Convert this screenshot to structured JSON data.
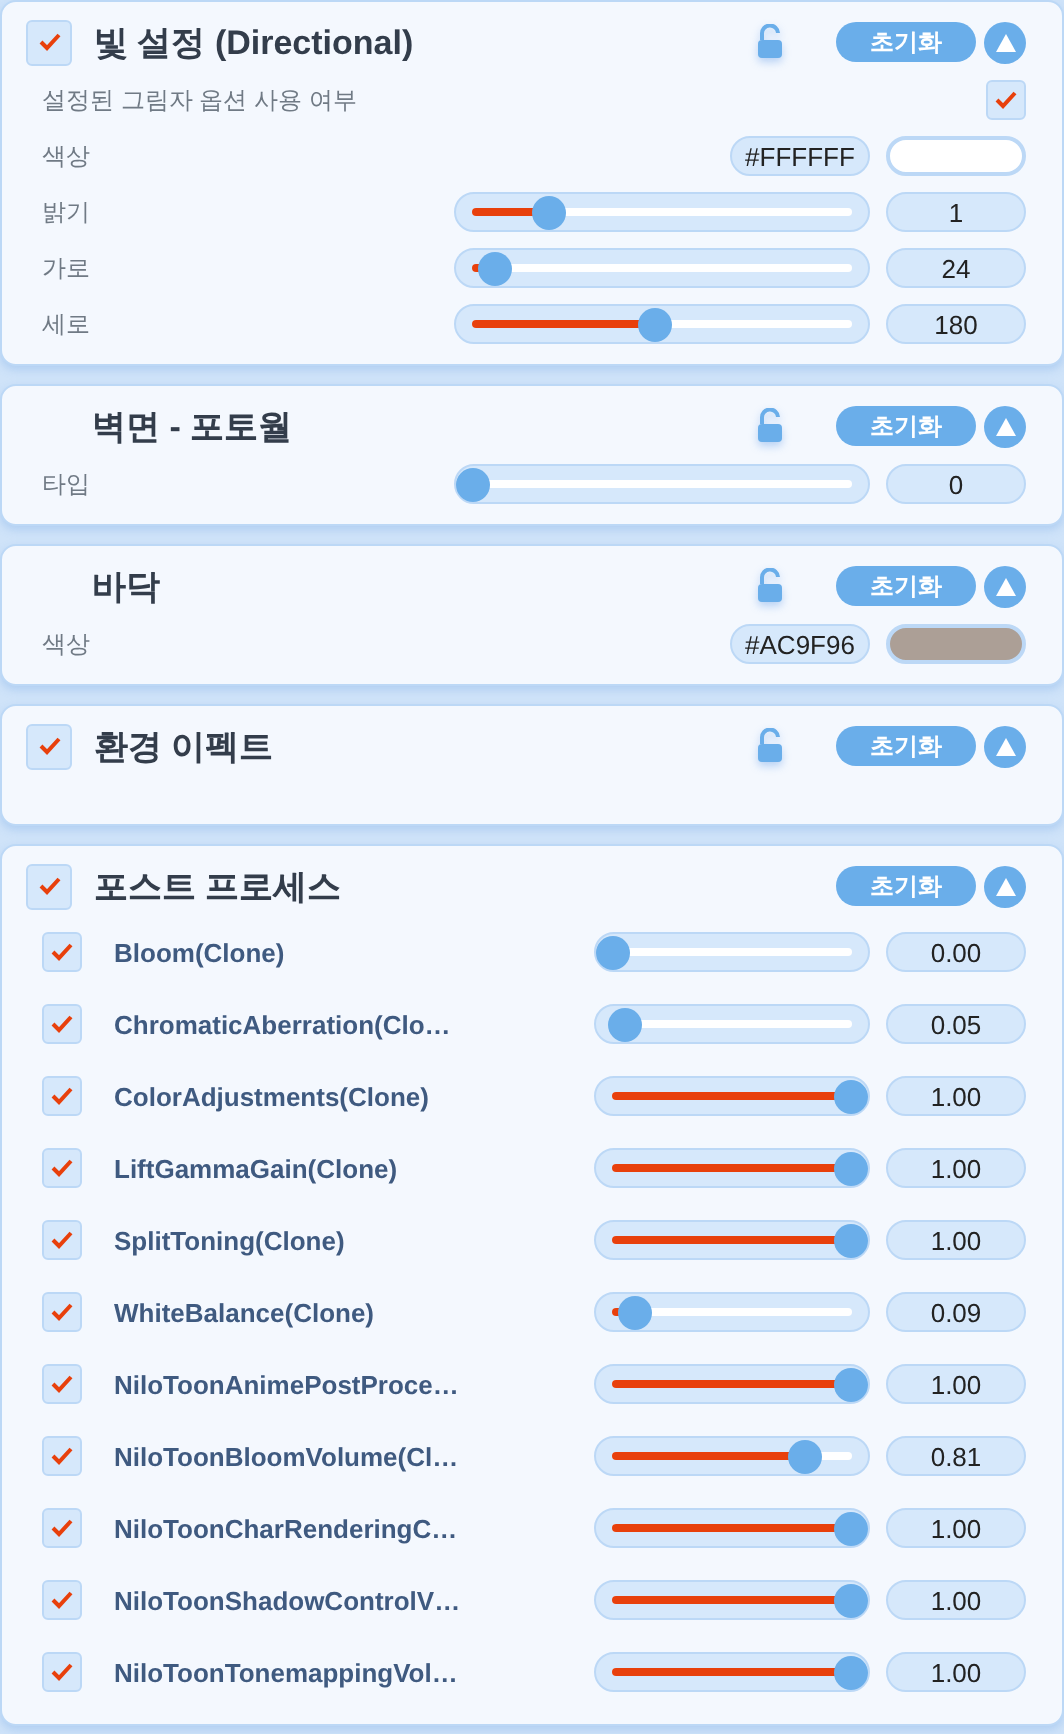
{
  "sections": [
    {
      "title": "빛 설정 (Directional)",
      "checkbox": {
        "checked": true
      },
      "lock": true,
      "reset_label": "초기화",
      "expanded": true,
      "rows": [
        {
          "kind": "toggle",
          "label": "설정된 그림자 옵션 사용 여부",
          "checked": true
        },
        {
          "kind": "color",
          "label": "색상",
          "hex": "#FFFFFF",
          "color": "#ffffff"
        },
        {
          "kind": "slider",
          "label": "밝기",
          "level": 0.2,
          "value": "1"
        },
        {
          "kind": "slider",
          "label": "가로",
          "level": 0.06,
          "value": "24"
        },
        {
          "kind": "slider",
          "label": "세로",
          "level": 0.48,
          "value": "180"
        }
      ]
    },
    {
      "title": "벽면 - 포토월",
      "lock": true,
      "reset_label": "초기화",
      "expanded": true,
      "rows": [
        {
          "kind": "slider",
          "label": "타입",
          "level": 0,
          "value": "0"
        }
      ]
    },
    {
      "title": "바닥",
      "lock": true,
      "reset_label": "초기화",
      "expanded": true,
      "rows": [
        {
          "kind": "color",
          "label": "색상",
          "hex": "#AC9F96",
          "color": "#ac9f96"
        }
      ]
    },
    {
      "title": "환경 이펙트",
      "checkbox": {
        "checked": true
      },
      "lock": true,
      "reset_label": "초기화",
      "expanded": true
    },
    {
      "title": "포스트 프로세스",
      "checkbox": {
        "checked": true
      },
      "lock": false,
      "reset_label": "초기화",
      "expanded": true,
      "rows": [
        {
          "kind": "effect",
          "label": "Bloom(Clone)",
          "checked": true,
          "level": 0,
          "value": "0.00"
        },
        {
          "kind": "effect",
          "label": "ChromaticAberration(Clo…",
          "checked": true,
          "level": 0.05,
          "value": "0.05"
        },
        {
          "kind": "effect",
          "label": "ColorAdjustments(Clone)",
          "checked": true,
          "level": 1,
          "value": "1.00"
        },
        {
          "kind": "effect",
          "label": "LiftGammaGain(Clone)",
          "checked": true,
          "level": 1,
          "value": "1.00"
        },
        {
          "kind": "effect",
          "label": "SplitToning(Clone)",
          "checked": true,
          "level": 1,
          "value": "1.00"
        },
        {
          "kind": "effect",
          "label": "WhiteBalance(Clone)",
          "checked": true,
          "level": 0.09,
          "value": "0.09"
        },
        {
          "kind": "effect",
          "label": "NiloToonAnimePostProce…",
          "checked": true,
          "level": 1,
          "value": "1.00"
        },
        {
          "kind": "effect",
          "label": "NiloToonBloomVolume(Cl…",
          "checked": true,
          "level": 0.81,
          "value": "0.81"
        },
        {
          "kind": "effect",
          "label": "NiloToonCharRenderingC…",
          "checked": true,
          "level": 1,
          "value": "1.00"
        },
        {
          "kind": "effect",
          "label": "NiloToonShadowControlV…",
          "checked": true,
          "level": 1,
          "value": "1.00"
        },
        {
          "kind": "effect",
          "label": "NiloToonTonemappingVol…",
          "checked": true,
          "level": 1,
          "value": "1.00"
        }
      ]
    }
  ]
}
